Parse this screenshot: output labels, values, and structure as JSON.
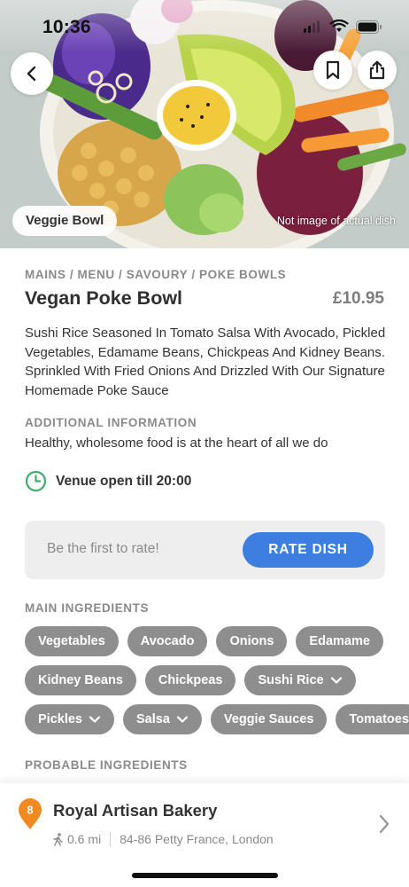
{
  "status_bar": {
    "time": "10:36"
  },
  "hero": {
    "tag": "Veggie Bowl",
    "disclaimer": "Not image of actual dish"
  },
  "dish": {
    "breadcrumb": "MAINS / MENU / SAVOURY / POKE BOWLS",
    "title": "Vegan Poke Bowl",
    "price": "£10.95",
    "description": "Sushi Rice Seasoned In Tomato Salsa With Avocado, Pickled Vegetables, Edamame Beans, Chickpeas And Kidney Beans. Sprinkled With Fried Onions And Drizzled With Our Signature Homemade Poke Sauce"
  },
  "additional": {
    "label": "ADDITIONAL INFORMATION",
    "text": "Healthy, wholesome food is at the heart of all we do"
  },
  "venue_hours": "Venue open till 20:00",
  "rating": {
    "prompt": "Be the first to rate!",
    "button": "RATE DISH"
  },
  "main_ingredients": {
    "label": "MAIN INGREDIENTS",
    "rows": [
      [
        {
          "label": "Vegetables",
          "dropdown": false
        },
        {
          "label": "Avocado",
          "dropdown": false
        },
        {
          "label": "Onions",
          "dropdown": false
        },
        {
          "label": "Edamame",
          "dropdown": false
        }
      ],
      [
        {
          "label": "Kidney Beans",
          "dropdown": false
        },
        {
          "label": "Chickpeas",
          "dropdown": false
        },
        {
          "label": "Sushi Rice",
          "dropdown": true
        }
      ],
      [
        {
          "label": "Pickles",
          "dropdown": true
        },
        {
          "label": "Salsa",
          "dropdown": true
        },
        {
          "label": "Veggie Sauces",
          "dropdown": false
        },
        {
          "label": "Tomatoes",
          "dropdown": false
        }
      ]
    ]
  },
  "probable_ingredients": {
    "label": "PROBABLE INGREDIENTS"
  },
  "restaurant": {
    "rank": "8",
    "name": "Royal Artisan Bakery",
    "distance": "0.6 mi",
    "address": "84-86 Petty France, London"
  },
  "colors": {
    "accent_blue": "#3d7fe0",
    "chip_grey": "#8e8e8e",
    "clock_green": "#3fae6a",
    "pin_orange": "#f28a22"
  }
}
